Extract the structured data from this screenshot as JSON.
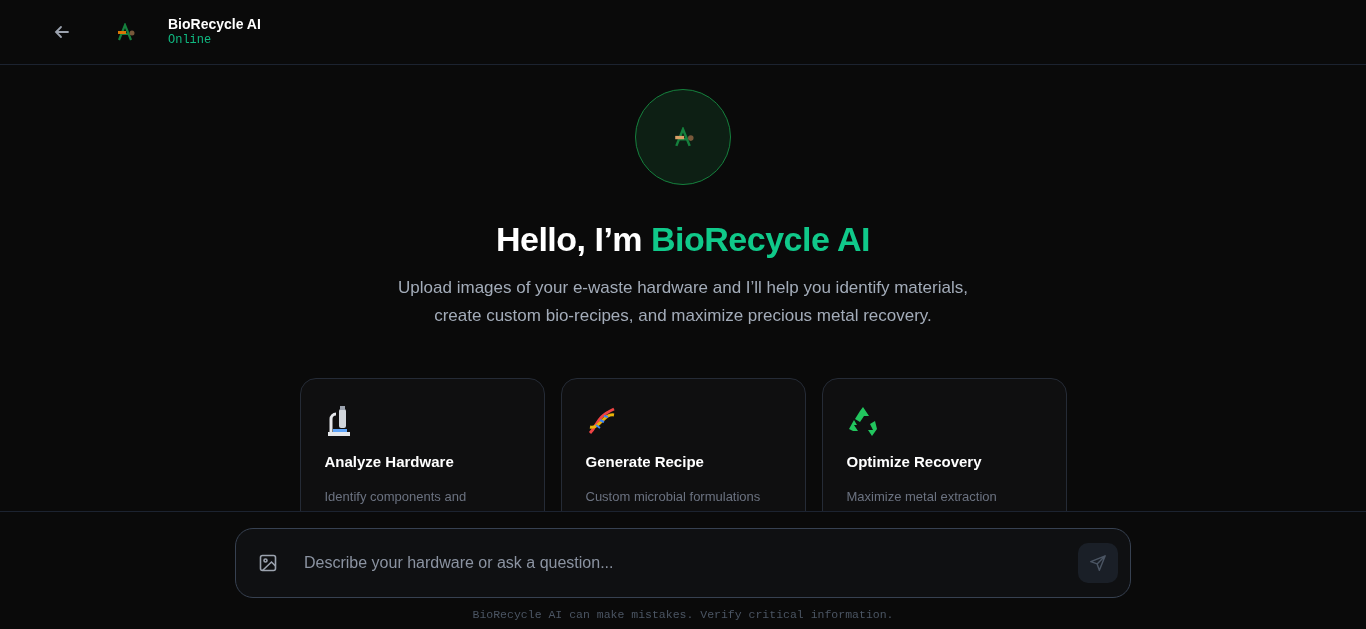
{
  "header": {
    "title": "BioRecycle AI",
    "status": "Online"
  },
  "hero": {
    "greeting": "Hello, I’m",
    "name": "BioRecycle AI",
    "subtitle": "Upload images of your e-waste hardware and I’ll help you identify materials, create custom bio-recipes, and maximize precious metal recovery."
  },
  "cards": [
    {
      "kind": "microscope",
      "title": "Analyze Hardware",
      "description": "Identify components and"
    },
    {
      "kind": "dna",
      "title": "Generate Recipe",
      "description": "Custom microbial formulations"
    },
    {
      "kind": "recycle",
      "title": "Optimize Recovery",
      "description": "Maximize metal extraction"
    }
  ],
  "composer": {
    "placeholder": "Describe your hardware or ask a question..."
  },
  "disclaimer": "BioRecycle AI can make mistakes. Verify critical information."
}
